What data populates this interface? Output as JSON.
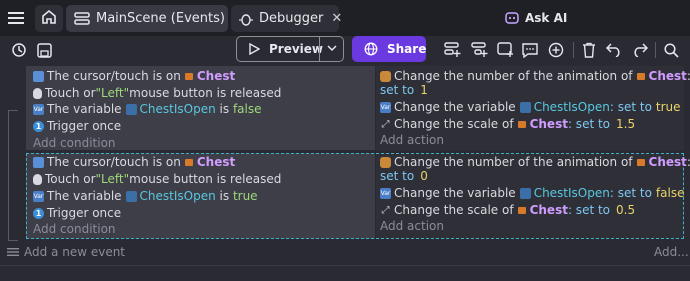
{
  "tabs": {
    "home_icon": "home-icon",
    "scene_tab": "MainScene (Events)",
    "debugger_tab": "Debugger",
    "close_glyph": "✕",
    "ask_ai": "Ask AI"
  },
  "toolbar": {
    "preview_label": "Preview",
    "share_label": "Share"
  },
  "event1": {
    "conditions": [
      {
        "pre": "The cursor/touch is on",
        "obj": "Chest"
      },
      {
        "pre": "Touch or ",
        "str": "\"Left\"",
        "post": " mouse button is released"
      },
      {
        "pre": "The variable",
        "var": "ChestIsOpen",
        "mid": " is ",
        "val": "false"
      },
      {
        "pre": "Trigger once"
      }
    ],
    "add_condition": "Add condition",
    "actions": {
      "a1_pre": "Change the number of the animation of",
      "a1_obj": "Chest",
      "a1_colon": ":",
      "a1_set": "set to",
      "a1_val": "1",
      "a2_pre": "Change the variable",
      "a2_var": "ChestIsOpen",
      "a2_set": ": set to",
      "a2_val": "true",
      "a3_pre": "Change the scale of",
      "a3_obj": "Chest",
      "a3_set": ": set to",
      "a3_val": "1.5"
    },
    "add_action": "Add action"
  },
  "event2": {
    "conditions": [
      {
        "pre": "The cursor/touch is on",
        "obj": "Chest"
      },
      {
        "pre": "Touch or ",
        "str": "\"Left\"",
        "post": " mouse button is released"
      },
      {
        "pre": "The variable",
        "var": "ChestIsOpen",
        "mid": " is ",
        "val": "true"
      },
      {
        "pre": "Trigger once"
      }
    ],
    "add_condition": "Add condition",
    "actions": {
      "a1_pre": "Change the number of the animation of",
      "a1_obj": "Chest",
      "a1_colon": ":",
      "a1_set": "set to",
      "a1_val": "0",
      "a2_pre": "Change the variable",
      "a2_var": "ChestIsOpen",
      "a2_set": ": set to",
      "a2_val": "false",
      "a3_pre": "Change the scale of",
      "a3_obj": "Chest",
      "a3_set": ": set to",
      "a3_val": "0.5"
    },
    "add_action": "Add action"
  },
  "footer": {
    "add_event": "Add a new event",
    "add_more": "Add..."
  },
  "colors": {
    "accent": "#6a39e0",
    "selection": "#3fb0c8",
    "object": "#d09cff",
    "variable": "#58c8e0",
    "value": "#e8d36a",
    "string": "#9fd87a"
  }
}
